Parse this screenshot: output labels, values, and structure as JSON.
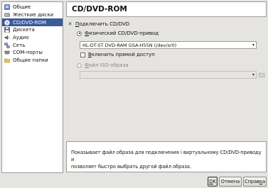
{
  "sidebar": {
    "items": [
      {
        "label": "Общие",
        "icon": "general-icon"
      },
      {
        "label": "Жесткие диски",
        "icon": "hard-disk-icon"
      },
      {
        "label": "CD/DVD-ROM",
        "icon": "cd-dvd-icon",
        "selected": true
      },
      {
        "label": "Дискета",
        "icon": "floppy-icon"
      },
      {
        "label": "Аудио",
        "icon": "audio-icon"
      },
      {
        "label": "Сеть",
        "icon": "network-icon"
      },
      {
        "label": "COM-порты",
        "icon": "com-port-icon"
      },
      {
        "label": "Общие папки",
        "icon": "shared-folder-icon"
      }
    ]
  },
  "main": {
    "title": "CD/DVD-ROM",
    "mount_checkbox": {
      "prefix": "",
      "mnemonic": "П",
      "rest": "одключить CD/DVD",
      "checked": true
    },
    "host_drive_radio": {
      "mnemonic": "Ф",
      "rest": "изический CD/DVD-привод",
      "checked": true
    },
    "host_drive_value": "HL-DT-ST DVD-RAM GSA-H55N (/dev/sr0)",
    "passthrough_checkbox": {
      "mnemonic": "В",
      "rest": "ключить прямой доступ",
      "checked": false
    },
    "iso_radio": {
      "mnemonic": "Ф",
      "rest": "айл ISO-образа",
      "checked": false
    },
    "iso_value": "",
    "info_text_line1": "Показывает файл образа для подключения і виртуальному CD/DVD-приводу и",
    "info_text_line2": "позволяет быстро выбрать другой файл образа."
  },
  "buttons": {
    "ok": {
      "mnemonic": "О",
      "rest": "K"
    },
    "cancel": "Отмена",
    "help": {
      "prefix": "Справ",
      "mnemonic": "к",
      "rest": "а"
    }
  },
  "colors": {
    "selection": "#3a5a9a",
    "window_bg": "#e6e4e0",
    "panel_border": "#9d9b96"
  }
}
